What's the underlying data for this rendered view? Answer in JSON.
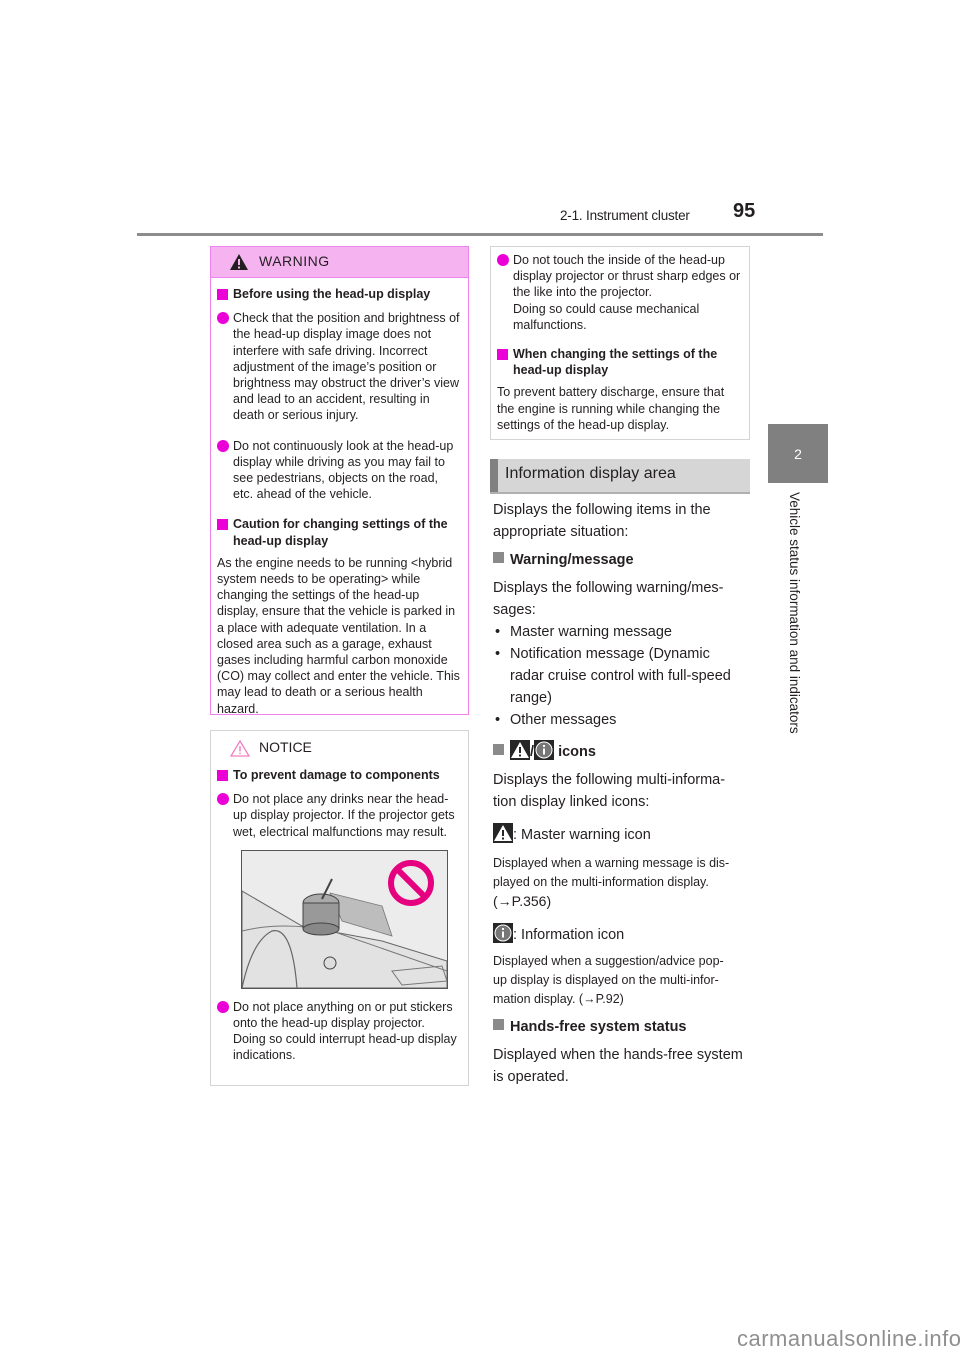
{
  "header": {
    "section": "2-1. Instrument cluster",
    "page_number": "95"
  },
  "side_tab": {
    "chapter_number": "2",
    "chapter_title": "Vehicle status information and indicators"
  },
  "warning_box": {
    "title": "WARNING",
    "heading1": "Before using the head-up display",
    "item1": "Check that the position and brightness of the head-up display image does not interfere with safe driving. Incorrect adjustment of the image’s position or brightness may obstruct the driver’s view and lead to an accident, resulting in death or serious injury.",
    "item2": "Do not continuously look at the head-up display while driving as you may fail to see pedestrians, objects on the road, etc. ahead of the vehicle.",
    "heading2": "Caution for changing settings of the head-up display",
    "paragraph": "As the engine needs to be running <hybrid system needs to be operating> while changing the settings of the head-up display, ensure that the vehicle is parked in a place with adequate ventilation. In a closed area such as a garage, exhaust gases including harmful carbon monoxide (CO) may collect and enter the vehicle. This may lead to death or a serious health hazard."
  },
  "notice_box": {
    "title": "NOTICE",
    "heading1": "To prevent damage to components",
    "item1": "Do not place any drinks near the head-up display projector. If the projector gets wet, electrical malfunctions may result.",
    "illustration": "drink-on-dashboard-prohibited",
    "item2": "Do not place anything on or put stickers onto the head-up display projector. Doing so could interrupt head-up display indications."
  },
  "notice_continued": {
    "item1": "Do not touch the inside of the head-up display projector or thrust sharp edges or the like into the projector.",
    "item1_b": "Doing so could cause mechanical malfunctions.",
    "heading": "When changing the settings of the head-up display",
    "paragraph": "To prevent battery discharge, ensure that the engine is running while changing the settings of the head-up display."
  },
  "section": {
    "title": "Information display area",
    "intro_1": "Displays the following items in the",
    "intro_2": "appropriate situation:",
    "sub1": {
      "title": "Warning/message",
      "desc_1": "Displays the following warning/mes-",
      "desc_2": "sages:",
      "bullets": [
        "Master warning message",
        "Notification message (Dynamic",
        "radar cruise control with full-speed",
        "range)",
        "Other messages"
      ]
    },
    "sub2": {
      "title_sep": "/",
      "title": "icons",
      "desc_1": "Displays the following multi-informa-",
      "desc_2": "tion display linked icons:",
      "master_label": ": Master warning icon",
      "master_desc_1": "Displayed when a warning message is dis-",
      "master_desc_2": "played on the multi-information display.",
      "master_ref": "(→P.356)",
      "info_label": ": Information icon",
      "info_desc_1": "Displayed when a suggestion/advice pop-",
      "info_desc_2": "up display is displayed on the multi-infor-",
      "info_desc_3": "mation display. (→P.92)"
    },
    "sub3": {
      "title": "Hands-free system status",
      "desc_1": "Displayed when the hands-free system",
      "desc_2": "is operated."
    }
  },
  "watermark": "carmanualsonline.info",
  "colors": {
    "warning_accent": "#ec00d8",
    "warning_header_bg": "#f5b4f0",
    "section_header_bg": "#d6d6d6",
    "chapter_tab": "#808080"
  }
}
